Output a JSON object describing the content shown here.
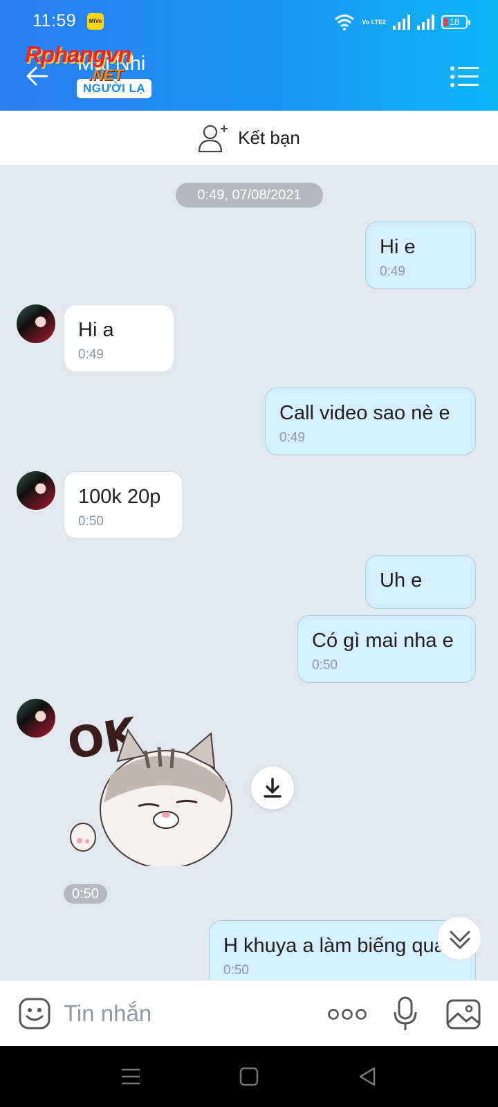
{
  "status_bar": {
    "time": "11:59",
    "carrier_badge": "MiVo",
    "volte": "Vo LTE2",
    "battery": "18"
  },
  "header": {
    "contact_name": "Mai Nhi",
    "stranger_tag": "NGƯỜI LẠ",
    "watermark": "Rphangvn",
    "watermark_net": ".NET"
  },
  "add_friend": {
    "label": "Kết bạn"
  },
  "chat": {
    "date": "0:49, 07/08/2021",
    "messages": [
      {
        "dir": "out",
        "text": "Hi e",
        "time": "0:49"
      },
      {
        "dir": "in",
        "text": "Hi a",
        "time": "0:49"
      },
      {
        "dir": "out",
        "text": "Call video sao nè e",
        "time": "0:49"
      },
      {
        "dir": "in",
        "text": "100k 20p",
        "time": "0:50"
      },
      {
        "dir": "out",
        "text": "Uh e",
        "time": ""
      },
      {
        "dir": "out",
        "text": "Có gì mai nha e",
        "time": "0:50"
      },
      {
        "dir": "out",
        "text": "H khuya a làm biếng quá",
        "time": "0:50"
      }
    ],
    "sticker": {
      "text": "OK",
      "time": "0:50"
    }
  },
  "composer": {
    "placeholder": "Tin nhắn"
  },
  "icons": {
    "back": "arrow-left-icon",
    "menu": "list-menu-icon",
    "add_friend": "add-person-icon",
    "download": "download-icon",
    "scroll_down": "double-chevron-down-icon",
    "emoji": "sticker-face-icon",
    "more": "more-dots-icon",
    "mic": "microphone-icon",
    "gallery": "image-icon"
  },
  "colors": {
    "header_start": "#2a7ef0",
    "header_end": "#0db6f5",
    "bubble_out": "#d5efff",
    "bubble_in": "#ffffff",
    "chat_bg": "#e2e8f0"
  }
}
